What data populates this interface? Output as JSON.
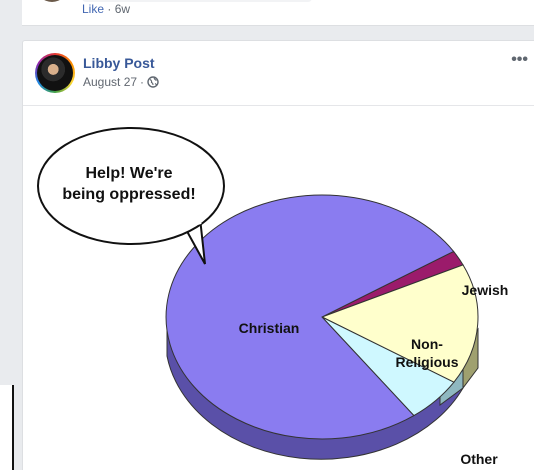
{
  "previous_post": {
    "like_label": "Like",
    "separator": " · ",
    "time": "6w"
  },
  "post": {
    "author": "Libby Post",
    "date": "August 27",
    "separator": " · ",
    "privacy_icon": "globe-icon",
    "more_icon": "more-icon",
    "more_label": "•••"
  },
  "meme": {
    "speech_bubble": [
      "Help! We're",
      "being oppressed!"
    ]
  },
  "chart_data": {
    "type": "pie",
    "categories": [
      "Christian",
      "Jewish",
      "Non-Religious",
      "Other"
    ],
    "values": [
      76,
      2,
      16,
      6
    ],
    "colors": [
      "#8a7cf0",
      "#9b1b6b",
      "#ffffcc",
      "#cff8ff"
    ]
  }
}
